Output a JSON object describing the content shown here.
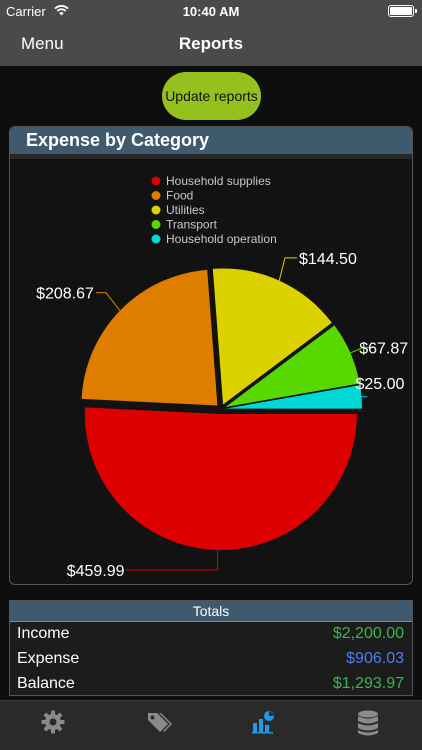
{
  "status_bar": {
    "carrier": "Carrier",
    "time": "10:40 AM"
  },
  "nav": {
    "menu_label": "Menu",
    "title": "Reports"
  },
  "update_button_label": "Update reports",
  "chart_panel": {
    "title": "Expense by Category"
  },
  "chart_data": {
    "type": "pie",
    "title": "Expense by Category",
    "legend_position": "top-center",
    "categories": [
      "Household supplies",
      "Food",
      "Utilities",
      "Transport",
      "Household operation"
    ],
    "values": [
      459.99,
      208.67,
      144.5,
      67.87,
      25.0
    ],
    "labels": [
      "$459.99",
      "$208.67",
      "$144.50",
      "$67.87",
      "$25.00"
    ],
    "colors": [
      "#dd0000",
      "#de7d00",
      "#dcd200",
      "#57d800",
      "#00d8d8"
    ]
  },
  "totals": {
    "title": "Totals",
    "rows": [
      {
        "label": "Income",
        "value": "$2,200.00",
        "color": "#3bb54a"
      },
      {
        "label": "Expense",
        "value": "$906.03",
        "color": "#4f7df0"
      },
      {
        "label": "Balance",
        "value": "$1,293.97",
        "color": "#3bb54a"
      }
    ]
  },
  "tabs": [
    {
      "icon": "gear-icon",
      "active": false
    },
    {
      "icon": "tags-icon",
      "active": false
    },
    {
      "icon": "reports-icon",
      "active": true
    },
    {
      "icon": "database-icon",
      "active": false
    }
  ]
}
